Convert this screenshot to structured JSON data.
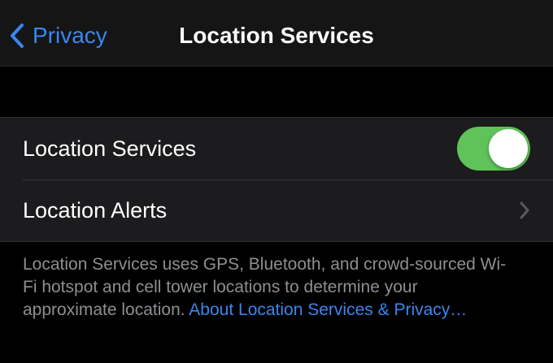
{
  "nav": {
    "back_label": "Privacy",
    "title": "Location Services"
  },
  "settings": {
    "rows": [
      {
        "label": "Location Services",
        "control": "toggle",
        "enabled": true
      },
      {
        "label": "Location Alerts",
        "control": "chevron"
      }
    ]
  },
  "footer": {
    "text": "Location Services uses GPS, Bluetooth, and crowd-sourced Wi-Fi hotspot and cell tower locations to determine your approximate location. ",
    "link": "About Location Services & Privacy…"
  },
  "colors": {
    "accent": "#3a86f0",
    "toggle_on": "#5fc35a",
    "background": "#000000",
    "group_background": "#1c1c1e",
    "secondary_text": "#8e8e93"
  },
  "icons": {
    "back": "chevron-left-icon",
    "disclosure": "chevron-right-icon"
  }
}
